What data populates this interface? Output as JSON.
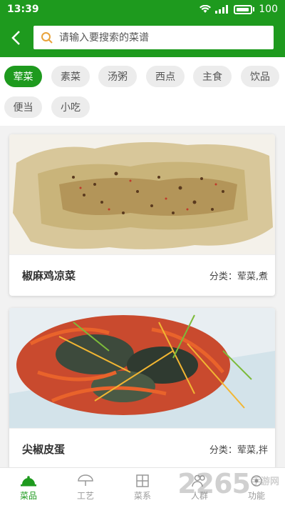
{
  "status": {
    "time": "13:39",
    "battery": "100"
  },
  "search": {
    "placeholder": "请输入要搜索的菜谱"
  },
  "categories": [
    {
      "label": "荤菜",
      "active": true
    },
    {
      "label": "素菜",
      "active": false
    },
    {
      "label": "汤粥",
      "active": false
    },
    {
      "label": "西点",
      "active": false
    },
    {
      "label": "主食",
      "active": false
    },
    {
      "label": "饮品",
      "active": false
    },
    {
      "label": "便当",
      "active": false
    },
    {
      "label": "小吃",
      "active": false
    }
  ],
  "recipes": [
    {
      "title": "椒麻鸡凉菜",
      "category_label": "分类：",
      "category_value": "荤菜,煮"
    },
    {
      "title": "尖椒皮蛋",
      "category_label": "分类：",
      "category_value": "荤菜,拌"
    }
  ],
  "tabs": [
    {
      "label": "菜品",
      "active": true
    },
    {
      "label": "工艺",
      "active": false
    },
    {
      "label": "菜系",
      "active": false
    },
    {
      "label": "人群",
      "active": false
    },
    {
      "label": "功能",
      "active": false
    }
  ],
  "watermark": {
    "text": "2265",
    "suffix": "手游网"
  },
  "colors": {
    "brand": "#1e9a1e",
    "chip_bg": "#ececec"
  }
}
